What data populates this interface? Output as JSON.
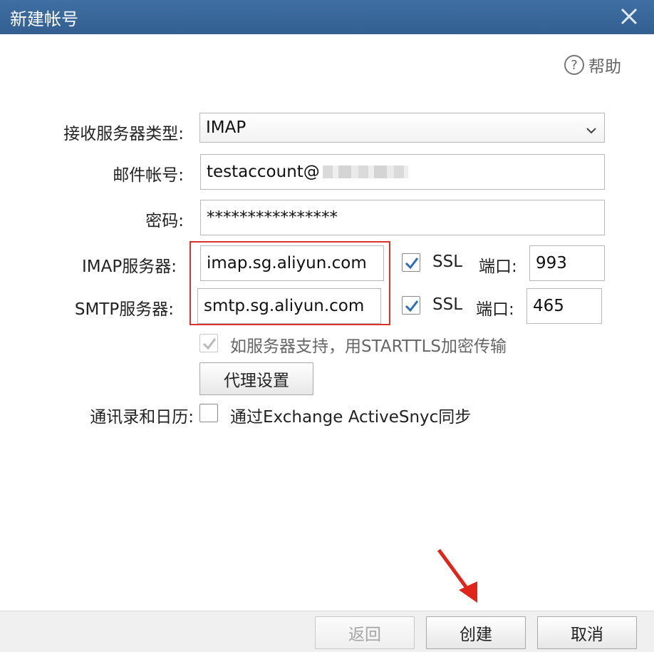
{
  "dialog": {
    "title": "新建帐号",
    "help_label": "帮助"
  },
  "form": {
    "server_type_label": "接收服务器类型:",
    "server_type_value": "IMAP",
    "account_label": "邮件帐号:",
    "account_value": "testaccount@",
    "password_label": "密码:",
    "password_value": "****************",
    "imap_label": "IMAP服务器:",
    "imap_value": "imap.sg.aliyun.com",
    "imap_ssl_label": "SSL",
    "imap_port_label": "端口:",
    "imap_port_value": "993",
    "smtp_label": "SMTP服务器:",
    "smtp_value": "smtp.sg.aliyun.com",
    "smtp_ssl_label": "SSL",
    "smtp_port_label": "端口:",
    "smtp_port_value": "465",
    "starttls_label": "如服务器支持，用STARTTLS加密传输",
    "proxy_button": "代理设置",
    "contacts_label": "通讯录和日历:",
    "exchange_label": "通过Exchange ActiveSnyc同步"
  },
  "footer": {
    "back_label": "返回",
    "create_label": "创建",
    "cancel_label": "取消"
  },
  "colors": {
    "titlebar": "#3a689b",
    "highlight_box": "#d9342b",
    "check": "#2f6db5",
    "arrow": "#e0261b"
  }
}
